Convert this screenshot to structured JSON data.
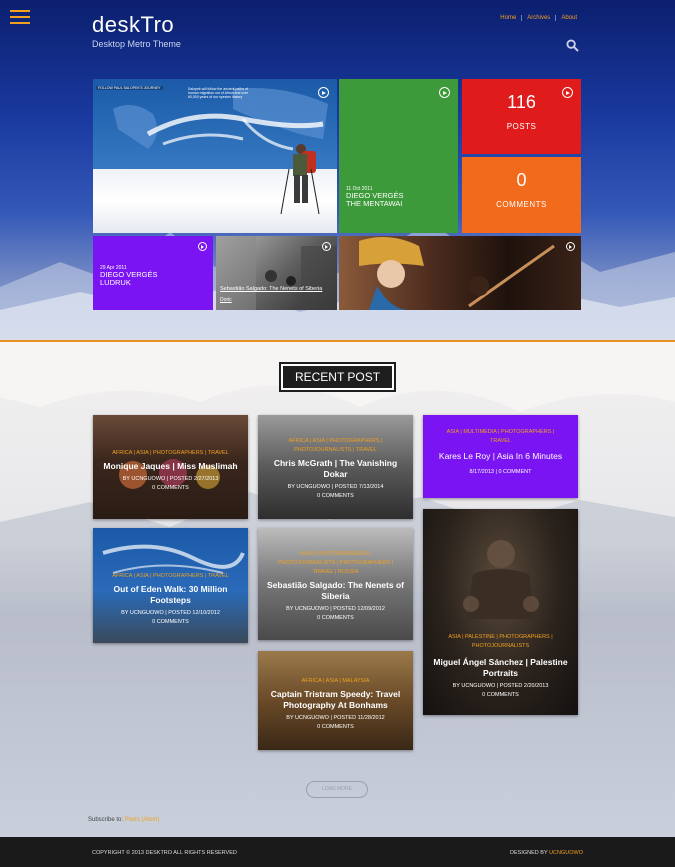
{
  "header": {
    "logo": "deskTro",
    "tagline": "Desktop Metro Theme",
    "nav": [
      "Home",
      "Archives",
      "About"
    ]
  },
  "tiles": {
    "green": {
      "date": "11 Oct 2011",
      "name1": "DIEGO VERGÉS",
      "name2": "THE MENTAWAI"
    },
    "posts": {
      "count": "116",
      "label": "POSTS"
    },
    "comments": {
      "count": "0",
      "label": "COMMENTS"
    },
    "purple": {
      "date": "29 Apr 2011",
      "name1": "DIEGO VERGÉS",
      "name2": "LUDRUK"
    },
    "bw_caption": "Sebastião Salgado: The Nenets of Siberia",
    "bw_sub": "Doric",
    "map_title": "FOLLOW PAUL SALOPEK'S JOURNEY",
    "map_text": "Salopek will follow the ancient paths of human migration out of Africa and over 60,000 years of our species history"
  },
  "section_title": "RECENT POST",
  "cards": [
    {
      "cats": "AFRICA | ASIA | PHOTOGRAPHERS | TRAVEL",
      "title": "Monique Jaques | Miss Muslimah",
      "meta": "BY UCNGUOWO | POSTED 2/27/2013",
      "comments": "0 COMMENTS"
    },
    {
      "cats": "AFRICA | ASIA | PHOTOGRAPHERS | TRAVEL",
      "title": "Out of Eden Walk: 30 Million Footsteps",
      "meta": "BY UCNGUOWO | POSTED 12/10/2012",
      "comments": "0 COMMENTS"
    },
    {
      "cats": "AFRICA | ASIA | PHOTOGRAPHERS | PHOTOJOURNALISTS | TRAVEL",
      "title": "Chris McGrath | The Vanishing Dokar",
      "meta": "BY UCNGUOWO | POSTED 7/13/2014",
      "comments": "0 COMMENTS"
    },
    {
      "cats": "ASIA | PHOTOGRAPHERS | PHOTOJOURNALISTS | PHOTOGRAPHERS | TRAVEL | RUSSIA",
      "title": "Sebastião Salgado: The Nenets of Siberia",
      "meta": "BY UCNGUOWO | POSTED 12/09/2012",
      "comments": "0 COMMENTS"
    },
    {
      "cats": "AFRICA | ASIA | MALAYSIA",
      "title": "Captain Tristram Speedy: Travel Photography At Bonhams",
      "meta": "BY UCNGUOWO | POSTED 11/28/2012",
      "comments": "0 COMMENTS"
    },
    {
      "cats": "ASIA | MULTIMEDIA | PHOTOGRAPHERS | TRAVEL",
      "title": "Kares Le Roy | Asia In 6 Minutes",
      "meta": "8/17/2013 | 0 COMMENT",
      "comments": ""
    },
    {
      "cats": "ASIA | PALESTINE | PHOTOGRAPHERS | PHOTOJOURNALISTS",
      "title": "Miguel Ángel Sánchez | Palestine Portraits",
      "meta": "BY UCNGUOWO | POSTED 2/20/2013",
      "comments": "0 COMMENTS"
    }
  ],
  "load_more": "LOAD MORE",
  "subscribe": {
    "text": "Subscribe to:",
    "link": "Posts (Atom)"
  },
  "footer": {
    "left": "COPYRIGHT © 2013 DESKTRO ALL RIGHTS RESERVED",
    "right_prefix": "DESIGNED BY",
    "right_link": "UCNGUOWO"
  },
  "colors": {
    "accent": "#f0a020",
    "green": "#3c9a3a",
    "red": "#e01b1b",
    "orange": "#f26a1b",
    "purple": "#7a14f2"
  }
}
